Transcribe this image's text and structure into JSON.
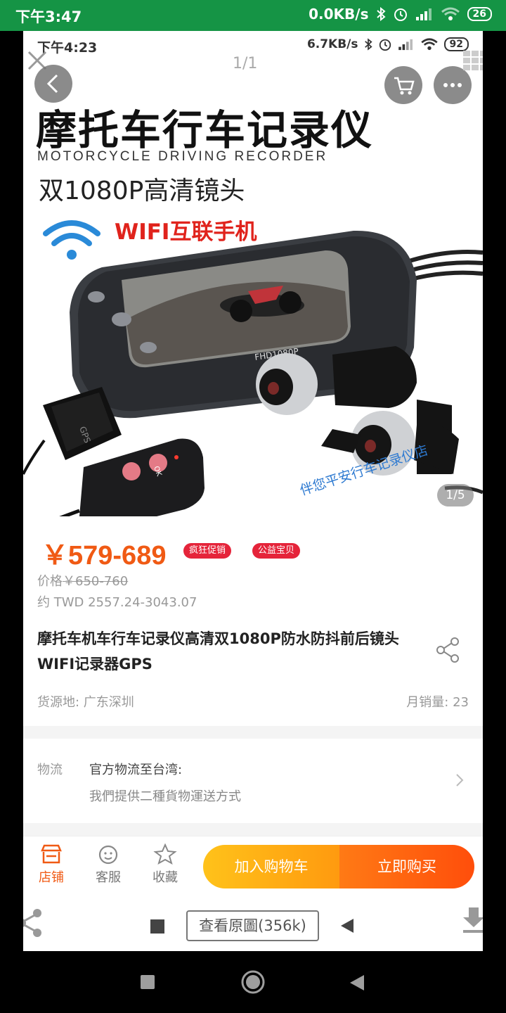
{
  "outer_status": {
    "time": "下午3:47",
    "net_speed": "0.0KB/s",
    "battery": "26"
  },
  "inner_status": {
    "time": "下午4:23",
    "net_speed": "6.7KB/s",
    "battery": "92"
  },
  "viewer": {
    "page_counter": "1/1",
    "view_original": "查看原圖(356k)"
  },
  "product_image": {
    "title_cn": "摩托车行车记录仪",
    "title_en": "MOTORCYCLE DRIVING RECORDER",
    "subtitle": "双1080P高清镜头",
    "wifi_label": "WIFI互联手机",
    "screen_label": "FHD1080P",
    "gps_label": "GPS",
    "remote_label": "OK",
    "watermark": "伴您平安行车记录仪店",
    "index": "1/5"
  },
  "price": {
    "current": "￥579-689",
    "badges": [
      "疯狂促销",
      "公益宝贝"
    ],
    "original_label": "价格",
    "original_value": "￥650-760",
    "twd": "约 TWD 2557.24-3043.07"
  },
  "product": {
    "title": "摩托车机车行车记录仪高清双1080P防水防抖前后镜头WIFI记录器GPS",
    "origin": "货源地: 广东深圳",
    "monthly_sales": "月销量: 23"
  },
  "logistics": {
    "label": "物流",
    "title": "官方物流至台湾:",
    "desc": "我們提供二種貨物運送方式"
  },
  "actions": {
    "shop": "店铺",
    "service": "客服",
    "favorite": "收藏",
    "add_to_cart": "加入购物车",
    "buy_now": "立即购买"
  },
  "colors": {
    "accent": "#f05a14",
    "status_bar": "#159445",
    "badge": "#e5243a"
  }
}
